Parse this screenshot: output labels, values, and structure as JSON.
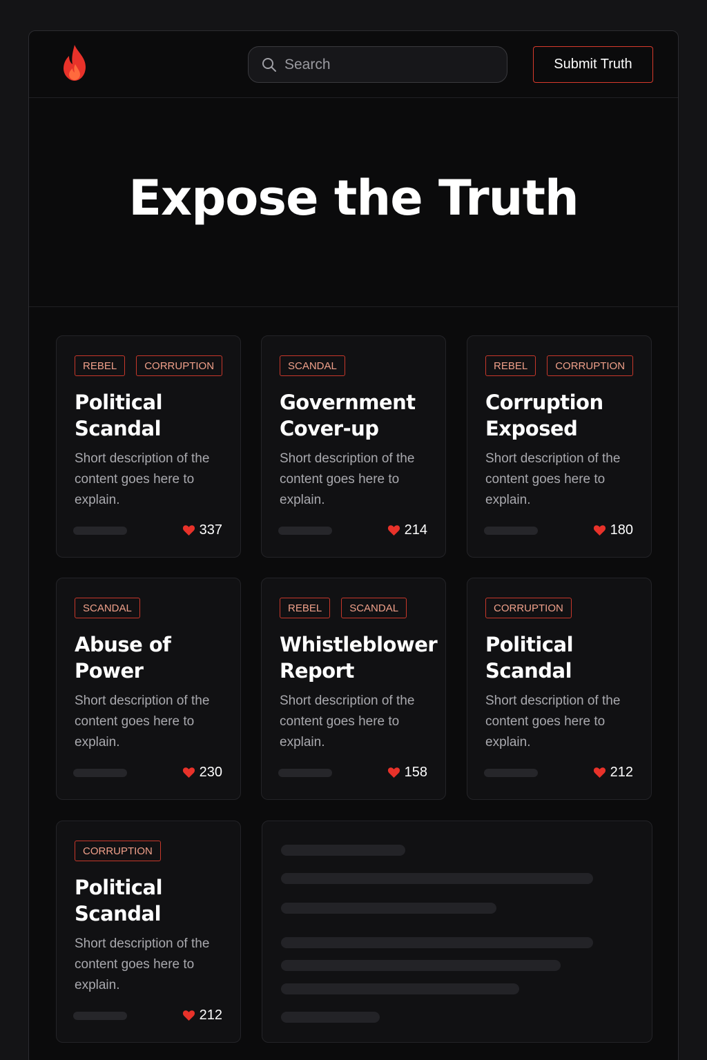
{
  "header": {
    "logo_icon": "flame-icon",
    "search_placeholder": "Search",
    "submit_label": "Submit Truth"
  },
  "hero": {
    "title": "Expose the Truth"
  },
  "colors": {
    "accent": "#e0392b",
    "tag_text": "#f0a08a",
    "background": "#0b0b0c",
    "card": "#111113"
  },
  "cards": [
    {
      "tags": [
        "REBEL",
        "CORRUPTION"
      ],
      "title": "Political Scandal",
      "description": "Short description of the content goes here to explain.",
      "likes": "337"
    },
    {
      "tags": [
        "SCANDAL"
      ],
      "title": "Government Cover-up",
      "description": "Short description of the content goes here to explain.",
      "likes": "214"
    },
    {
      "tags": [
        "REBEL",
        "CORRUPTION"
      ],
      "title": "Corruption Exposed",
      "description": "Short description of the content goes here to explain.",
      "likes": "180"
    },
    {
      "tags": [
        "SCANDAL"
      ],
      "title": "Abuse of Power",
      "description": "Short description of the content goes here to explain.",
      "likes": "230"
    },
    {
      "tags": [
        "REBEL",
        "SCANDAL"
      ],
      "title": "Whistleblower Report",
      "description": "Short description of the content goes here to explain.",
      "likes": "158"
    },
    {
      "tags": [
        "CORRUPTION"
      ],
      "title": "Political Scandal",
      "description": "Short description of the content goes here to explain.",
      "likes": "212"
    },
    {
      "tags": [
        "CORRUPTION"
      ],
      "title": "Political Scandal",
      "description": "Short description of the content goes here to explain.",
      "likes": "212"
    }
  ]
}
